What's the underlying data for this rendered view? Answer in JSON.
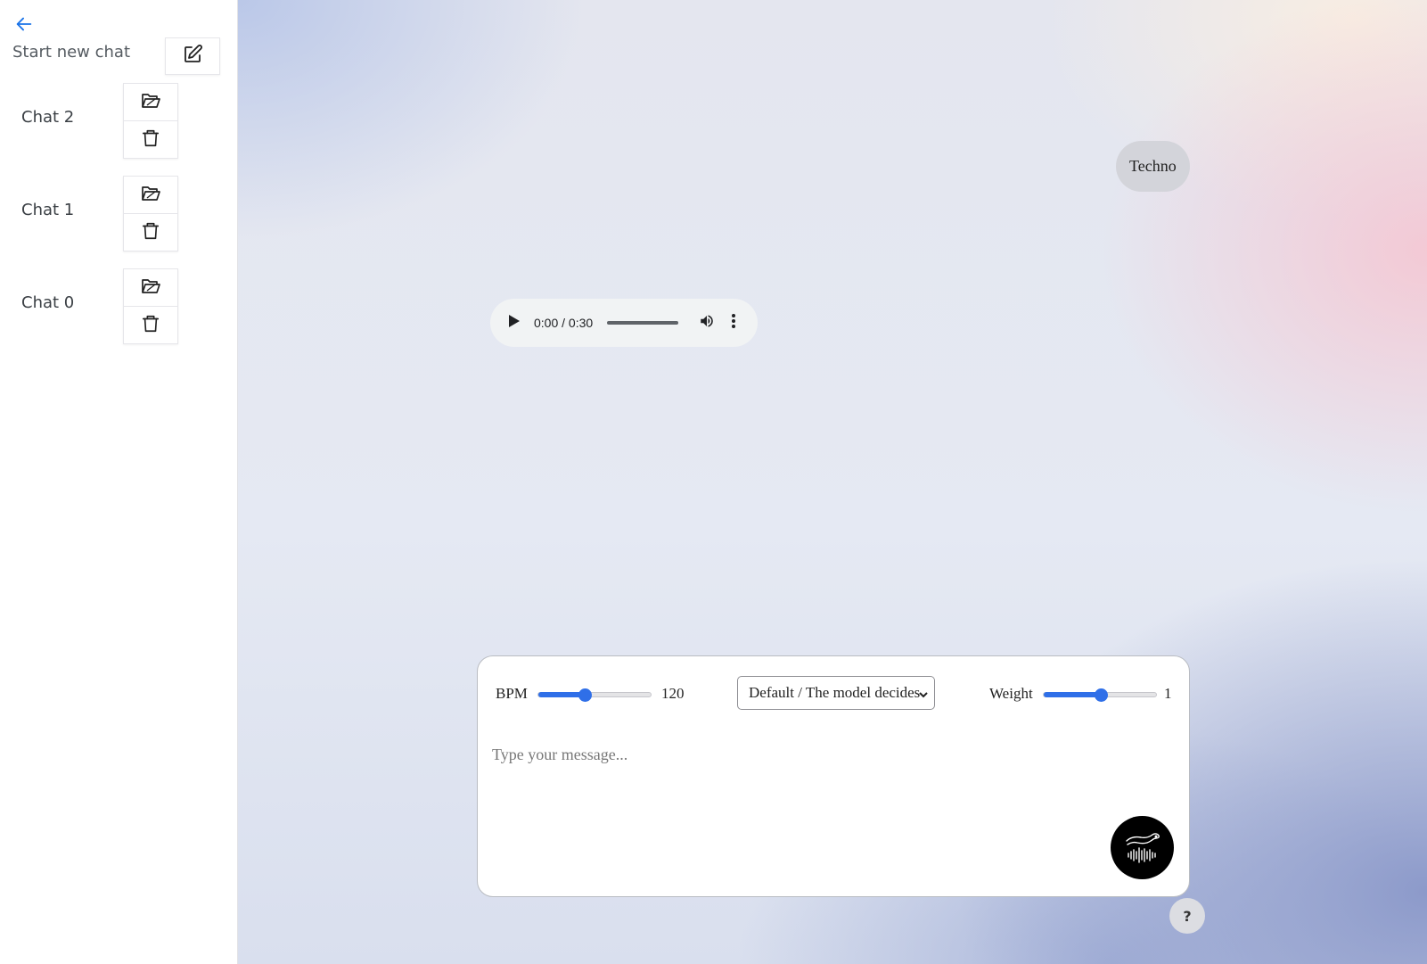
{
  "sidebar": {
    "new_chat_label": "Start new chat",
    "chats": [
      {
        "name": "Chat 2"
      },
      {
        "name": "Chat 1"
      },
      {
        "name": "Chat 0"
      }
    ]
  },
  "conversation": {
    "user_message": "Techno",
    "audio": {
      "current_time": "0:00",
      "duration": "0:30",
      "time_display": "0:00 / 0:30",
      "progress": 0
    }
  },
  "composer": {
    "bpm": {
      "label": "BPM",
      "value": "120",
      "min": 60,
      "max": 200,
      "level": 0.41
    },
    "mode_select": {
      "selected": "Default / The model decides"
    },
    "weight": {
      "label": "Weight",
      "value": "1",
      "level": 0.5
    },
    "message_placeholder": "Type your message...",
    "message_value": ""
  },
  "help": {
    "label": "?"
  },
  "colors": {
    "accent": "#2f6fe8",
    "back_arrow": "#1a73e8",
    "bubble": "#d3d4da",
    "send_button": "#000000"
  },
  "icons": {
    "back": "arrow-left-icon",
    "new_chat": "edit-icon",
    "open_chat": "folder-open-icon",
    "delete_chat": "trash-icon",
    "play": "play-icon",
    "volume": "volume-icon",
    "more": "more-vertical-icon",
    "send": "otter-waveform-logo-icon"
  }
}
